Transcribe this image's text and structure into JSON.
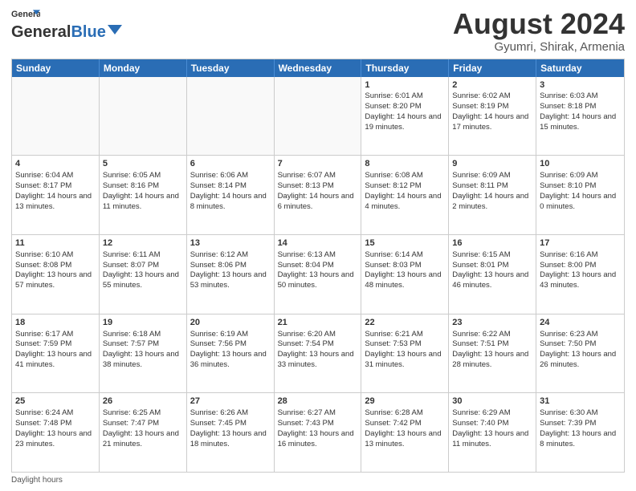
{
  "logo": {
    "line1": "General",
    "line2": "Blue"
  },
  "title": "August 2024",
  "subtitle": "Gyumri, Shirak, Armenia",
  "header_days": [
    "Sunday",
    "Monday",
    "Tuesday",
    "Wednesday",
    "Thursday",
    "Friday",
    "Saturday"
  ],
  "footer": "Daylight hours",
  "weeks": [
    [
      {
        "day": "",
        "info": "",
        "empty": true
      },
      {
        "day": "",
        "info": "",
        "empty": true
      },
      {
        "day": "",
        "info": "",
        "empty": true
      },
      {
        "day": "",
        "info": "",
        "empty": true
      },
      {
        "day": "1",
        "info": "Sunrise: 6:01 AM\nSunset: 8:20 PM\nDaylight: 14 hours and 19 minutes.",
        "empty": false
      },
      {
        "day": "2",
        "info": "Sunrise: 6:02 AM\nSunset: 8:19 PM\nDaylight: 14 hours and 17 minutes.",
        "empty": false
      },
      {
        "day": "3",
        "info": "Sunrise: 6:03 AM\nSunset: 8:18 PM\nDaylight: 14 hours and 15 minutes.",
        "empty": false
      }
    ],
    [
      {
        "day": "4",
        "info": "Sunrise: 6:04 AM\nSunset: 8:17 PM\nDaylight: 14 hours and 13 minutes.",
        "empty": false
      },
      {
        "day": "5",
        "info": "Sunrise: 6:05 AM\nSunset: 8:16 PM\nDaylight: 14 hours and 11 minutes.",
        "empty": false
      },
      {
        "day": "6",
        "info": "Sunrise: 6:06 AM\nSunset: 8:14 PM\nDaylight: 14 hours and 8 minutes.",
        "empty": false
      },
      {
        "day": "7",
        "info": "Sunrise: 6:07 AM\nSunset: 8:13 PM\nDaylight: 14 hours and 6 minutes.",
        "empty": false
      },
      {
        "day": "8",
        "info": "Sunrise: 6:08 AM\nSunset: 8:12 PM\nDaylight: 14 hours and 4 minutes.",
        "empty": false
      },
      {
        "day": "9",
        "info": "Sunrise: 6:09 AM\nSunset: 8:11 PM\nDaylight: 14 hours and 2 minutes.",
        "empty": false
      },
      {
        "day": "10",
        "info": "Sunrise: 6:09 AM\nSunset: 8:10 PM\nDaylight: 14 hours and 0 minutes.",
        "empty": false
      }
    ],
    [
      {
        "day": "11",
        "info": "Sunrise: 6:10 AM\nSunset: 8:08 PM\nDaylight: 13 hours and 57 minutes.",
        "empty": false
      },
      {
        "day": "12",
        "info": "Sunrise: 6:11 AM\nSunset: 8:07 PM\nDaylight: 13 hours and 55 minutes.",
        "empty": false
      },
      {
        "day": "13",
        "info": "Sunrise: 6:12 AM\nSunset: 8:06 PM\nDaylight: 13 hours and 53 minutes.",
        "empty": false
      },
      {
        "day": "14",
        "info": "Sunrise: 6:13 AM\nSunset: 8:04 PM\nDaylight: 13 hours and 50 minutes.",
        "empty": false
      },
      {
        "day": "15",
        "info": "Sunrise: 6:14 AM\nSunset: 8:03 PM\nDaylight: 13 hours and 48 minutes.",
        "empty": false
      },
      {
        "day": "16",
        "info": "Sunrise: 6:15 AM\nSunset: 8:01 PM\nDaylight: 13 hours and 46 minutes.",
        "empty": false
      },
      {
        "day": "17",
        "info": "Sunrise: 6:16 AM\nSunset: 8:00 PM\nDaylight: 13 hours and 43 minutes.",
        "empty": false
      }
    ],
    [
      {
        "day": "18",
        "info": "Sunrise: 6:17 AM\nSunset: 7:59 PM\nDaylight: 13 hours and 41 minutes.",
        "empty": false
      },
      {
        "day": "19",
        "info": "Sunrise: 6:18 AM\nSunset: 7:57 PM\nDaylight: 13 hours and 38 minutes.",
        "empty": false
      },
      {
        "day": "20",
        "info": "Sunrise: 6:19 AM\nSunset: 7:56 PM\nDaylight: 13 hours and 36 minutes.",
        "empty": false
      },
      {
        "day": "21",
        "info": "Sunrise: 6:20 AM\nSunset: 7:54 PM\nDaylight: 13 hours and 33 minutes.",
        "empty": false
      },
      {
        "day": "22",
        "info": "Sunrise: 6:21 AM\nSunset: 7:53 PM\nDaylight: 13 hours and 31 minutes.",
        "empty": false
      },
      {
        "day": "23",
        "info": "Sunrise: 6:22 AM\nSunset: 7:51 PM\nDaylight: 13 hours and 28 minutes.",
        "empty": false
      },
      {
        "day": "24",
        "info": "Sunrise: 6:23 AM\nSunset: 7:50 PM\nDaylight: 13 hours and 26 minutes.",
        "empty": false
      }
    ],
    [
      {
        "day": "25",
        "info": "Sunrise: 6:24 AM\nSunset: 7:48 PM\nDaylight: 13 hours and 23 minutes.",
        "empty": false
      },
      {
        "day": "26",
        "info": "Sunrise: 6:25 AM\nSunset: 7:47 PM\nDaylight: 13 hours and 21 minutes.",
        "empty": false
      },
      {
        "day": "27",
        "info": "Sunrise: 6:26 AM\nSunset: 7:45 PM\nDaylight: 13 hours and 18 minutes.",
        "empty": false
      },
      {
        "day": "28",
        "info": "Sunrise: 6:27 AM\nSunset: 7:43 PM\nDaylight: 13 hours and 16 minutes.",
        "empty": false
      },
      {
        "day": "29",
        "info": "Sunrise: 6:28 AM\nSunset: 7:42 PM\nDaylight: 13 hours and 13 minutes.",
        "empty": false
      },
      {
        "day": "30",
        "info": "Sunrise: 6:29 AM\nSunset: 7:40 PM\nDaylight: 13 hours and 11 minutes.",
        "empty": false
      },
      {
        "day": "31",
        "info": "Sunrise: 6:30 AM\nSunset: 7:39 PM\nDaylight: 13 hours and 8 minutes.",
        "empty": false
      }
    ]
  ]
}
